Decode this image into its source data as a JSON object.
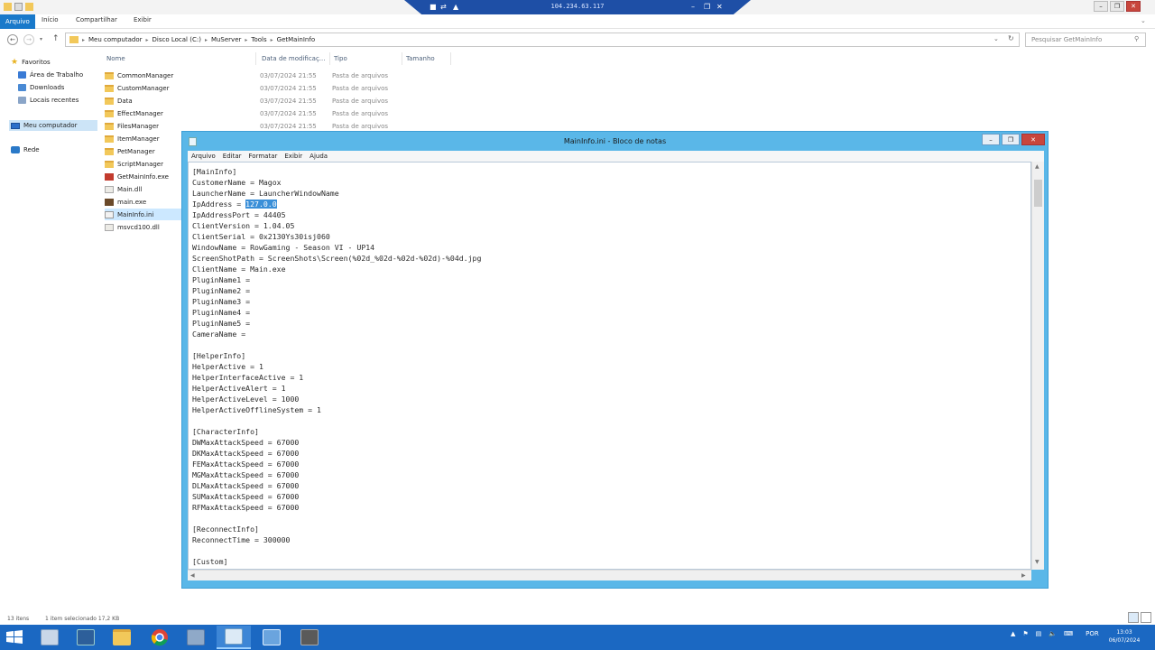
{
  "remote_bar": {
    "ip": "104.234.63.117"
  },
  "ribbon": {
    "tabs": [
      "Arquivo",
      "Início",
      "Compartilhar",
      "Exibir"
    ]
  },
  "breadcrumb": [
    "Meu computador",
    "Disco Local (C:)",
    "MuServer",
    "Tools",
    "GetMainInfo"
  ],
  "search": {
    "placeholder": "Pesquisar GetMainInfo"
  },
  "nav": {
    "favorites": "Favoritos",
    "desktop": "Área de Trabalho",
    "downloads": "Downloads",
    "recent": "Locais recentes",
    "computer": "Meu computador",
    "network": "Rede"
  },
  "columns": {
    "name": "Nome",
    "date": "Data de modificaç...",
    "type": "Tipo",
    "size": "Tamanho"
  },
  "files": [
    {
      "name": "CommonManager",
      "date": "03/07/2024 21:55",
      "type": "Pasta de arquivos",
      "icon": "folder"
    },
    {
      "name": "CustomManager",
      "date": "03/07/2024 21:55",
      "type": "Pasta de arquivos",
      "icon": "folder"
    },
    {
      "name": "Data",
      "date": "03/07/2024 21:55",
      "type": "Pasta de arquivos",
      "icon": "folder"
    },
    {
      "name": "EffectManager",
      "date": "03/07/2024 21:55",
      "type": "Pasta de arquivos",
      "icon": "folder"
    },
    {
      "name": "FilesManager",
      "date": "03/07/2024 21:55",
      "type": "Pasta de arquivos",
      "icon": "folder"
    },
    {
      "name": "ItemManager",
      "date": "",
      "type": "",
      "icon": "folder"
    },
    {
      "name": "PetManager",
      "date": "",
      "type": "",
      "icon": "folder"
    },
    {
      "name": "ScriptManager",
      "date": "",
      "type": "",
      "icon": "folder"
    },
    {
      "name": "GetMainInfo.exe",
      "date": "",
      "type": "",
      "icon": "exe1"
    },
    {
      "name": "Main.dll",
      "date": "",
      "type": "",
      "icon": "dll"
    },
    {
      "name": "main.exe",
      "date": "",
      "type": "",
      "icon": "exe2"
    },
    {
      "name": "MainInfo.ini",
      "date": "",
      "type": "",
      "icon": "ini"
    },
    {
      "name": "msvcd100.dll",
      "date": "",
      "type": "",
      "icon": "dll"
    }
  ],
  "status": {
    "count": "13 itens",
    "selected": "1 item selecionado  17,2 KB"
  },
  "notepad": {
    "title": "MainInfo.ini - Bloco de notas",
    "menu": [
      "Arquivo",
      "Editar",
      "Formatar",
      "Exibir",
      "Ajuda"
    ],
    "selected_text": "127.0.0",
    "lines": [
      "[MainInfo]",
      "CustomerName = Magox",
      "LauncherName = LauncherWindowName",
      "IpAddress = ",
      "IpAddressPort = 44405",
      "ClientVersion = 1.04.05",
      "ClientSerial = 0x2130Ys30isj060",
      "WindowName = RowGaming - Season VI - UP14",
      "ScreenShotPath = ScreenShots\\Screen(%02d_%02d-%02d-%02d)-%04d.jpg",
      "ClientName = Main.exe",
      "PluginName1 =",
      "PluginName2 =",
      "PluginName3 =",
      "PluginName4 =",
      "PluginName5 =",
      "CameraName =",
      "",
      "[HelperInfo]",
      "HelperActive = 1",
      "HelperInterfaceActive = 1",
      "HelperActiveAlert = 1",
      "HelperActiveLevel = 1000",
      "HelperActiveOfflineSystem = 1",
      "",
      "[CharacterInfo]",
      "DWMaxAttackSpeed = 67000",
      "DKMaxAttackSpeed = 67000",
      "FEMaxAttackSpeed = 67000",
      "MGMaxAttackSpeed = 67000",
      "DLMaxAttackSpeed = 67000",
      "SUMaxAttackSpeed = 67000",
      "RFMaxAttackSpeed = 67000",
      "",
      "[ReconnectInfo]",
      "ReconnectTime = 300000",
      "",
      "[Custom]"
    ]
  },
  "tray": {
    "lang": "POR",
    "time": "13:03",
    "date": "06/07/2024"
  },
  "colors": {
    "taskbar": "#1b68c2",
    "notepad_frame": "#5ab7e8",
    "accent": "#1979ca"
  }
}
